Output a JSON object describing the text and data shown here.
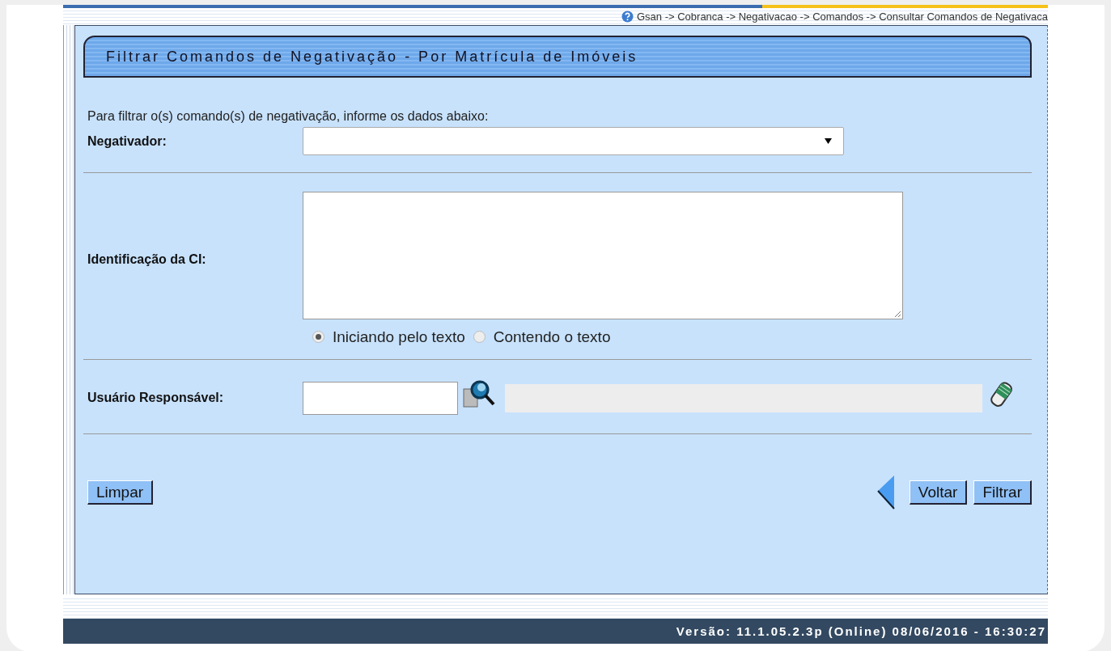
{
  "breadcrumb": "Gsan -> Cobranca -> Negativacao -> Comandos -> Consultar Comandos de Negativaca",
  "title": "Filtrar Comandos de Negativação - Por Matrícula de Imóveis",
  "instruction": "Para filtrar o(s) comando(s) de negativação, informe os dados abaixo:",
  "fields": [
    {
      "kind": "select",
      "label": "Negativador:"
    },
    {
      "kind": "textarea",
      "label": "Identificação da CI:",
      "options": [
        {
          "label": "Iniciando pelo texto",
          "selected": true
        },
        {
          "label": "Contendo o texto",
          "selected": false
        }
      ]
    },
    {
      "kind": "lookup",
      "label": "Usuário Responsável:"
    }
  ],
  "buttons_left": [
    "Limpar"
  ],
  "buttons_right": [
    "Voltar",
    "Filtrar"
  ],
  "status_bar": "Versão: 11.1.05.2.3p (Online) 08/06/2016 - 16:30:27"
}
